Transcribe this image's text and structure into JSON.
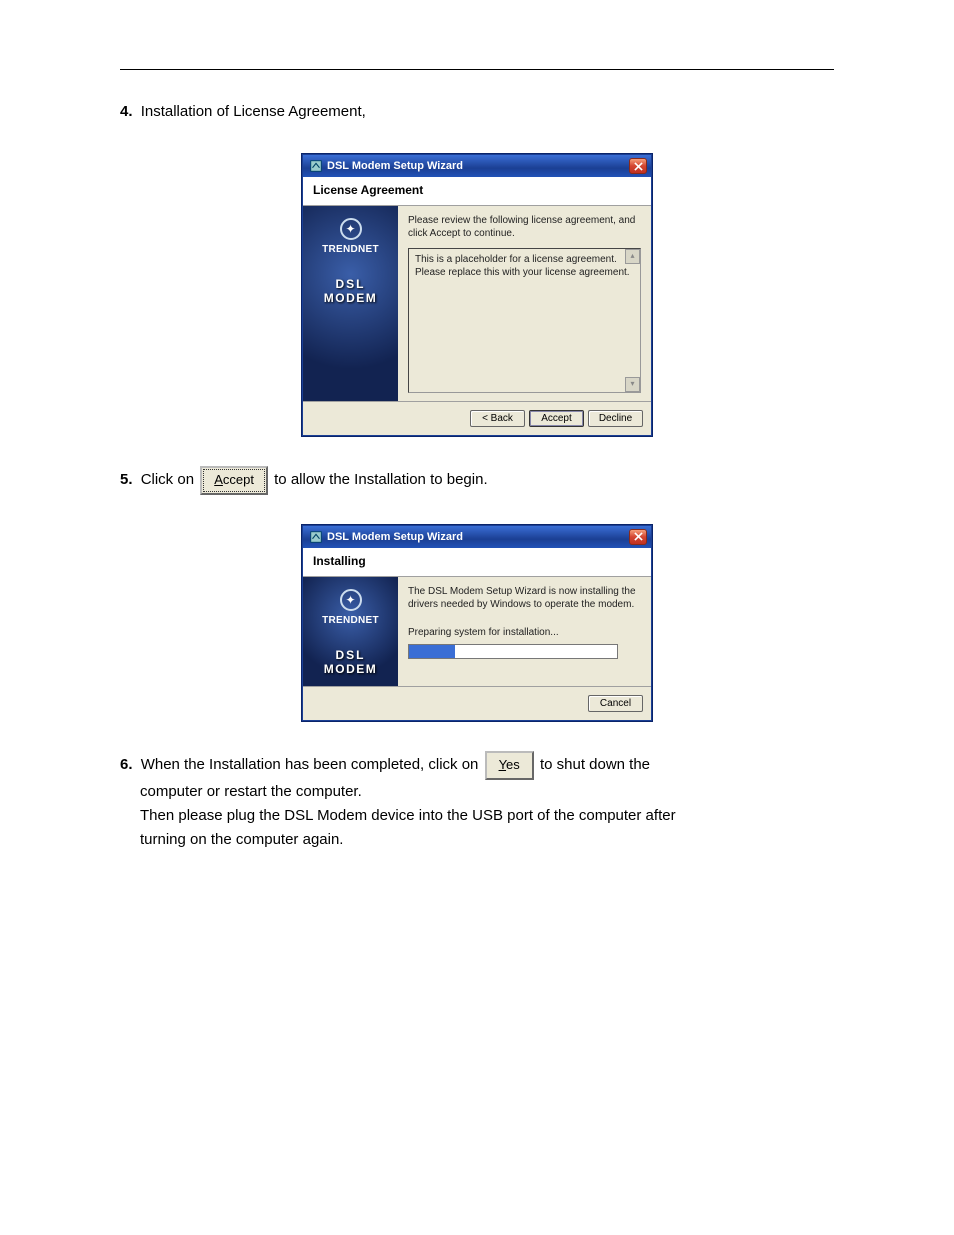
{
  "step4": {
    "num": "4.",
    "text": "Installation of License Agreement,"
  },
  "dialog1": {
    "title": "DSL Modem Setup Wizard",
    "heading": "License Agreement",
    "intro": "Please review the following license agreement, and click Accept to continue.",
    "license_text": "This is a placeholder for a license agreement.  Please replace this with your license agreement.",
    "brand": {
      "name": "TRENDNET",
      "prod1": "DSL",
      "prod2": "MODEM"
    },
    "buttons": {
      "back": "< Back",
      "accept": "Accept",
      "decline": "Decline"
    }
  },
  "step5": {
    "num": "5.",
    "prefix": "Click on ",
    "btn_u": "A",
    "btn_rest": "ccept",
    "suffix": " to allow the Installation to begin."
  },
  "dialog2": {
    "title": "DSL Modem Setup Wizard",
    "heading": "Installing",
    "intro": "The DSL Modem Setup Wizard is now installing the drivers needed by Windows to operate the modem.",
    "status": "Preparing system for installation...",
    "brand": {
      "name": "TRENDNET",
      "prod1": "DSL",
      "prod2": "MODEM"
    },
    "buttons": {
      "cancel": "Cancel"
    },
    "progress_percent": 22
  },
  "step6": {
    "num": "6.",
    "line1_pre": "When the Installation has been completed, click on ",
    "btn_u": "Y",
    "btn_rest": "es",
    "line1_post": " to shut down the",
    "line2": "computer or restart the computer.",
    "line3": "Then please plug the DSL Modem device into the USB port of the computer after",
    "line4": "turning on the computer again."
  }
}
